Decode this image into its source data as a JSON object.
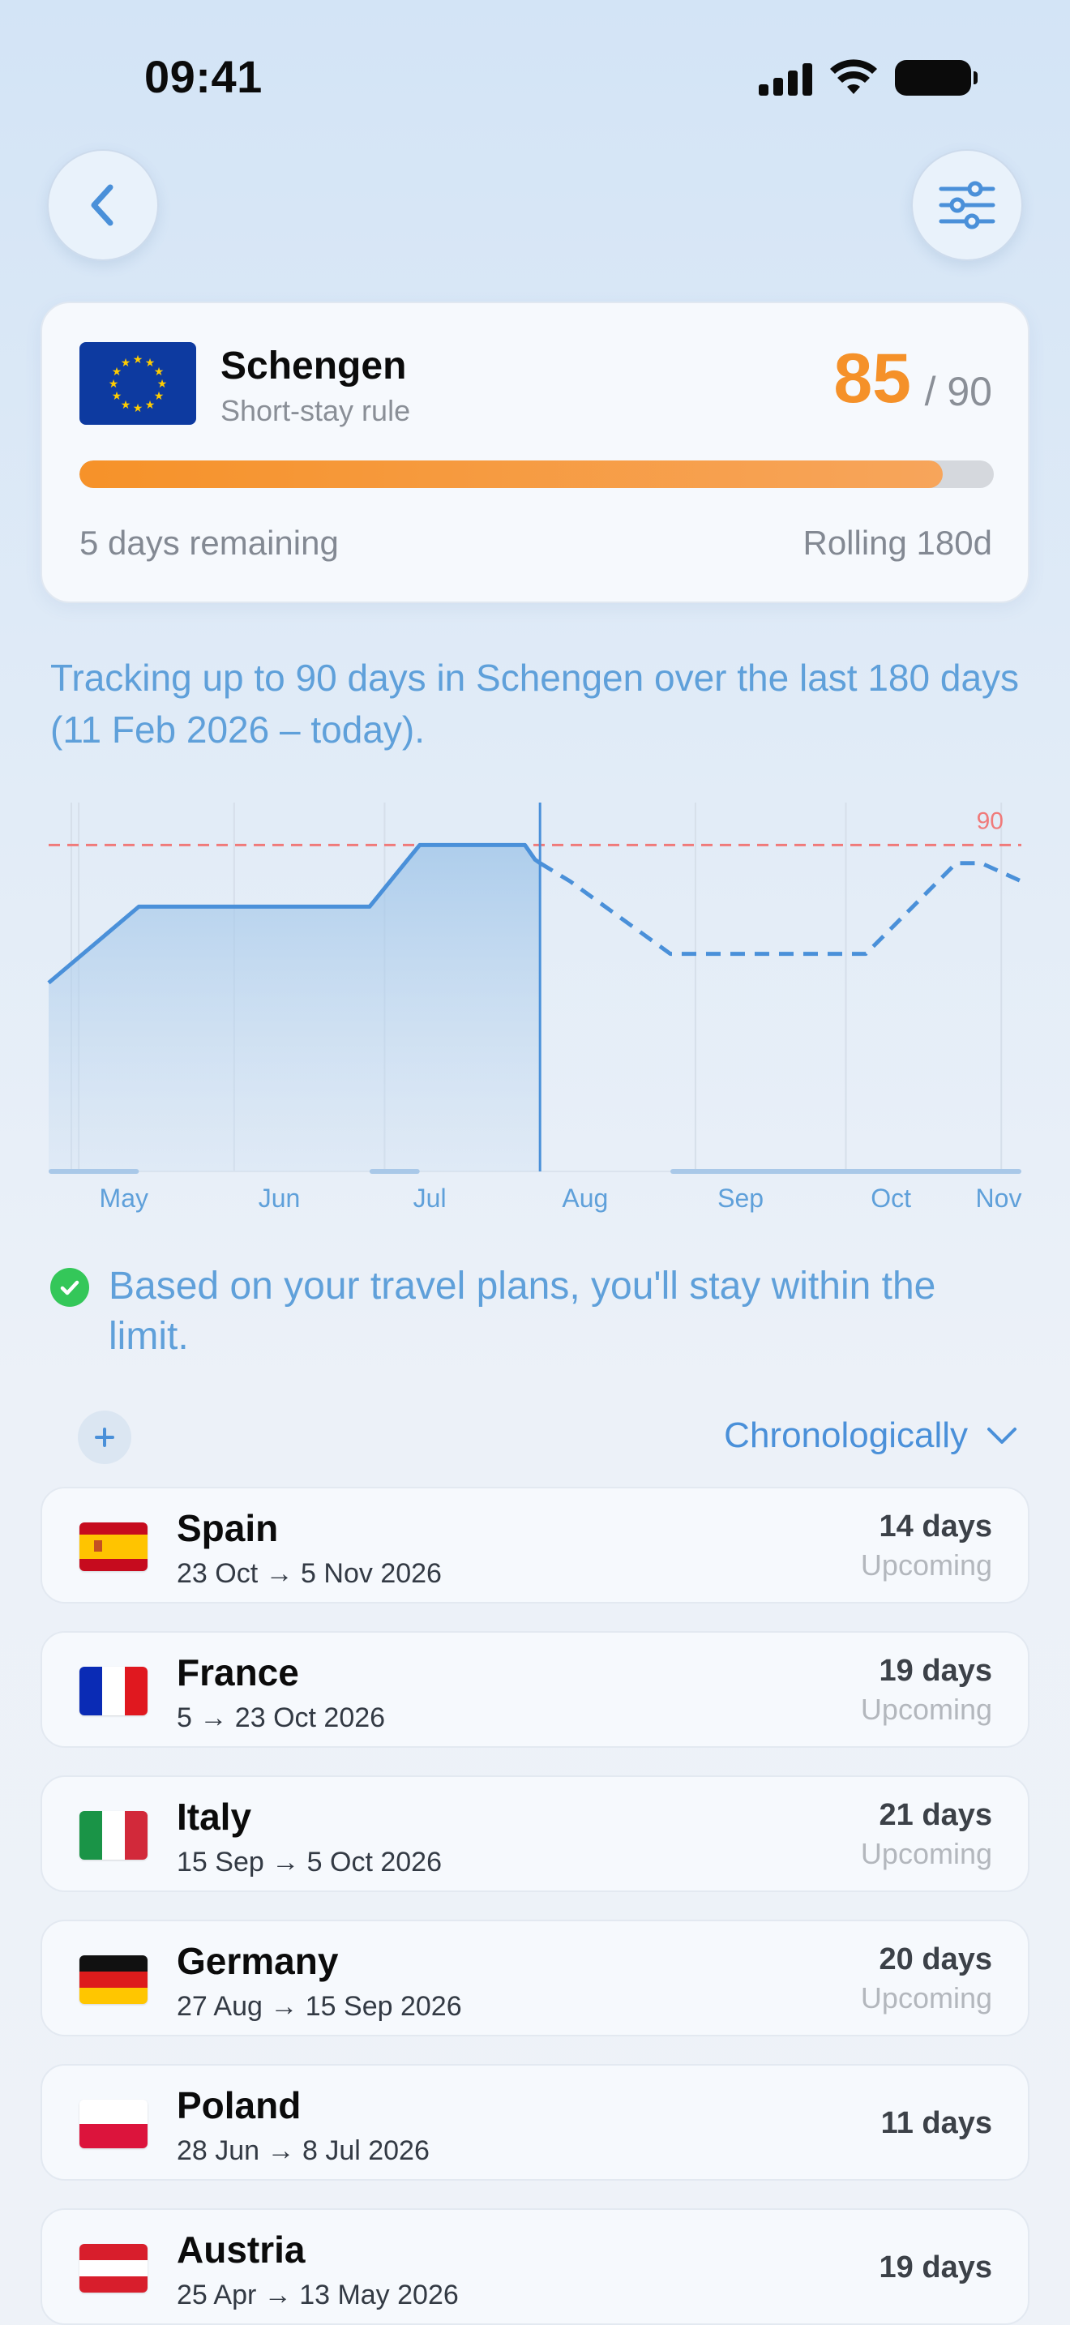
{
  "status_bar": {
    "time": "09:41"
  },
  "card": {
    "title": "Schengen",
    "subtitle": "Short-stay rule",
    "days_used": "85",
    "days_limit": "/ 90",
    "progress_fraction": 0.944,
    "remaining": "5 days remaining",
    "rolling": "Rolling 180d",
    "accent": "#f59129"
  },
  "explanation": "Tracking up to 90 days in Schengen over the last 180 days (11 Feb 2026 – today).",
  "chart_data": {
    "type": "line",
    "x_labels": [
      "May",
      "Jun",
      "Jul",
      "Aug",
      "Sep",
      "Oct",
      "Nov"
    ],
    "limit_value": 90,
    "limit_label": "90",
    "ylim": [
      0,
      95
    ],
    "today": "2026-08-01",
    "actual_series": {
      "x": [
        "2026-04-25",
        "2026-05-13",
        "2026-06-28",
        "2026-07-08",
        "2026-07-29",
        "2026-07-31",
        "2026-08-01"
      ],
      "values": [
        52,
        73,
        73,
        90,
        90,
        86,
        85
      ]
    },
    "projected_series": {
      "x": [
        "2026-08-01",
        "2026-08-07",
        "2026-08-27",
        "2026-09-15",
        "2026-10-05",
        "2026-10-23",
        "2026-10-28",
        "2026-11-05"
      ],
      "values": [
        85,
        80,
        60,
        60,
        60,
        85,
        85,
        80
      ]
    },
    "trip_ranges": [
      [
        "2026-04-25",
        "2026-05-13"
      ],
      [
        "2026-06-28",
        "2026-07-08"
      ],
      [
        "2026-08-27",
        "2026-11-05"
      ]
    ],
    "colors": {
      "line": "#4a90d9",
      "limit": "#f07a7a"
    },
    "grid": true
  },
  "within_message": "Based on your travel plans, you'll stay within the limit.",
  "sort": {
    "label": "Chronologically"
  },
  "trips": [
    {
      "country": "Spain",
      "dates": "23 Oct → 5 Nov 2026",
      "days": "14 days",
      "status": "Upcoming",
      "flag": "es"
    },
    {
      "country": "France",
      "dates": "5 → 23 Oct 2026",
      "days": "19 days",
      "status": "Upcoming",
      "flag": "fr"
    },
    {
      "country": "Italy",
      "dates": "15 Sep → 5 Oct 2026",
      "days": "21 days",
      "status": "Upcoming",
      "flag": "it"
    },
    {
      "country": "Germany",
      "dates": "27 Aug → 15 Sep 2026",
      "days": "20 days",
      "status": "Upcoming",
      "flag": "de"
    },
    {
      "country": "Poland",
      "dates": "28 Jun → 8 Jul 2026",
      "days": "11 days",
      "status": "",
      "flag": "pl"
    },
    {
      "country": "Austria",
      "dates": "25 Apr → 13 May 2026",
      "days": "19 days",
      "status": "",
      "flag": "at"
    }
  ]
}
